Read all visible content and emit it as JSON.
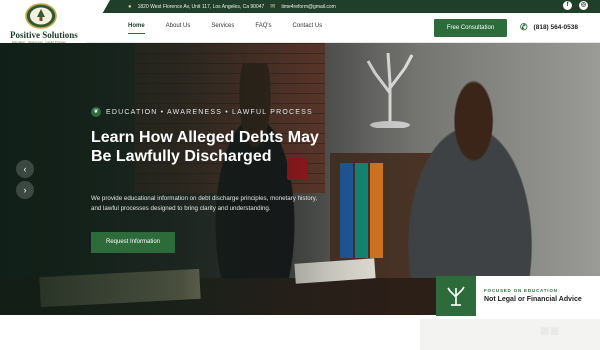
{
  "brand": {
    "name": "Positive Solutions",
    "tagline": "Education · Awareness · Lawful Process"
  },
  "topbar": {
    "address": "1820 West Florence Av, Unit 117, Los Angeles, Ca 90047",
    "email": "time4reform@gmail.com",
    "social": [
      "facebook-icon",
      "instagram-icon"
    ]
  },
  "nav": {
    "items": [
      "Home",
      "About Us",
      "Services",
      "FAQ's",
      "Contact Us"
    ],
    "active": "Home",
    "cta": "Free Consultation",
    "phone": "(818) 564-0538"
  },
  "hero": {
    "eyebrow": "EDUCATION • AWARENESS • LAWFUL PROCESS",
    "headline": "Learn How Alleged Debts May Be Lawfully Discharged",
    "lead": "We provide educational information on debt discharge principles, monetary history, and lawful processes designed to bring clarity and understanding.",
    "button": "Request Information"
  },
  "info_card": {
    "kicker": "FOCUSED ON EDUCATION",
    "value": "Not Legal or Financial Advice"
  },
  "colors": {
    "brand_green": "#2d6b3b",
    "topbar": "#1f3f2a"
  }
}
